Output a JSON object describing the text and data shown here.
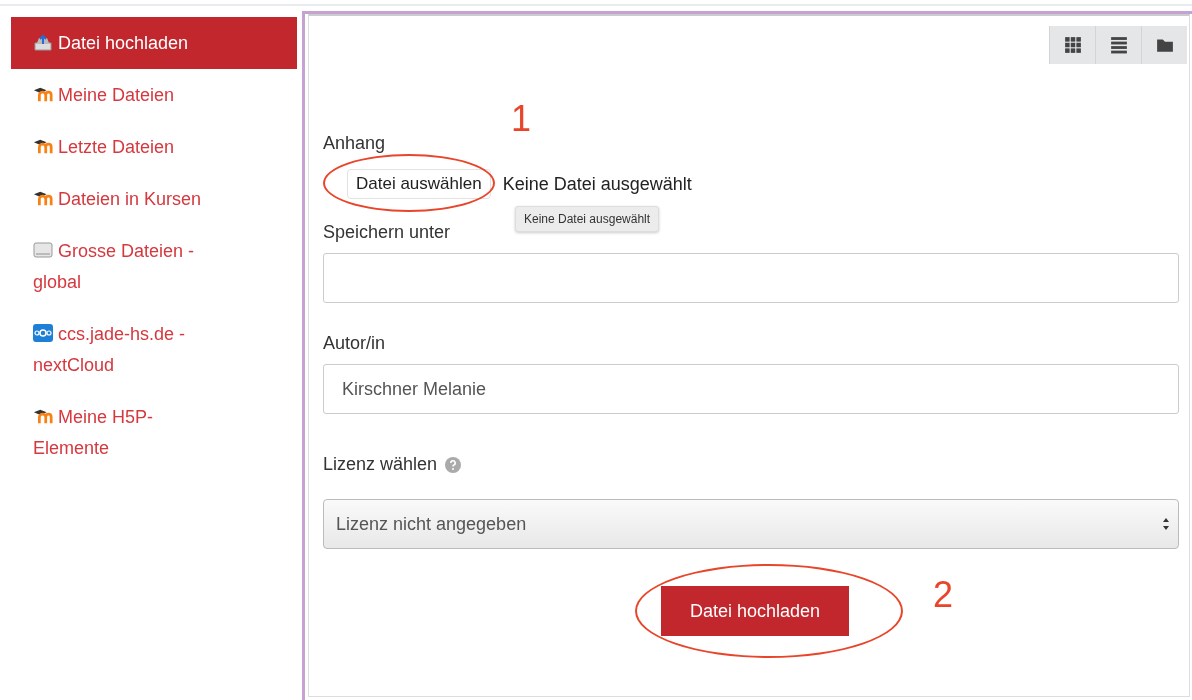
{
  "sidebar": {
    "items": [
      {
        "label": "Datei hochladen",
        "kind": "upload",
        "selected": true
      },
      {
        "label": "Meine Dateien",
        "kind": "moodle",
        "selected": false
      },
      {
        "label": "Letzte Dateien",
        "kind": "moodle",
        "selected": false
      },
      {
        "label": "Dateien in Kursen",
        "kind": "moodle",
        "selected": false
      },
      {
        "label": "Grosse Dateien - global",
        "kind": "drive",
        "selected": false
      },
      {
        "label": "ccs.jade-hs.de - nextCloud",
        "kind": "cloud",
        "selected": false
      },
      {
        "label": "Meine H5P-Elemente",
        "kind": "moodle",
        "selected": false
      }
    ]
  },
  "view_buttons": [
    {
      "kind": "grid"
    },
    {
      "kind": "list"
    },
    {
      "kind": "folder"
    }
  ],
  "form": {
    "attachment": {
      "label": "Anhang",
      "button": "Datei auswählen",
      "status": "Keine Datei ausgewählt",
      "tooltip": "Keine Datei ausgewählt",
      "annotation": "1"
    },
    "save_as": {
      "label": "Speichern unter"
    },
    "author": {
      "label": "Autor/in",
      "value": "Kirschner Melanie"
    },
    "license": {
      "label": "Lizenz wählen",
      "value": "Lizenz nicht angegeben"
    },
    "submit": {
      "label": "Datei hochladen",
      "annotation": "2"
    }
  }
}
